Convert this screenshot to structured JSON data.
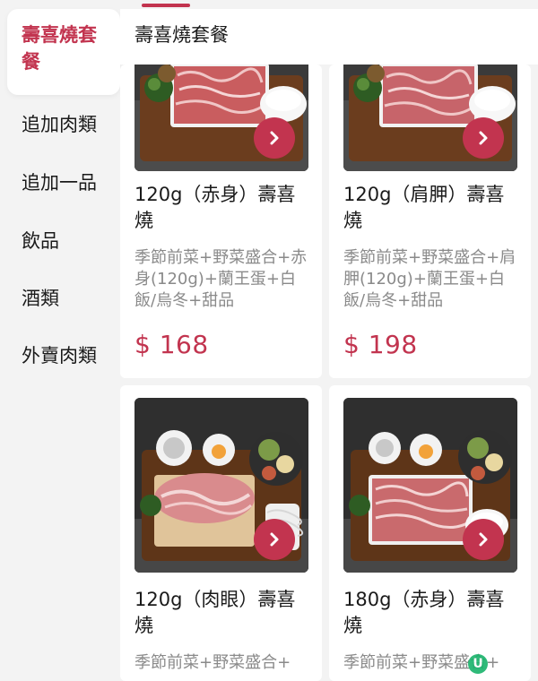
{
  "sidebar": {
    "items": [
      {
        "label": "壽喜燒套餐",
        "active": true
      },
      {
        "label": "追加肉類",
        "active": false
      },
      {
        "label": "追加一品",
        "active": false
      },
      {
        "label": "飲品",
        "active": false
      },
      {
        "label": "酒類",
        "active": false
      },
      {
        "label": "外賣肉類",
        "active": false
      }
    ]
  },
  "section": {
    "title": "壽喜燒套餐"
  },
  "products": [
    {
      "title": "120g（赤身）壽喜燒",
      "description": "季節前菜+野菜盛合+赤身(120g)+蘭王蛋+白飯/烏冬+甜品",
      "price": "$ 168"
    },
    {
      "title": "120g（肩胛）壽喜燒",
      "description": "季節前菜+野菜盛合+肩胛(120g)+蘭王蛋+白飯/烏冬+甜品",
      "price": "$ 198"
    },
    {
      "title": "120g（肉眼）壽喜燒",
      "description": "季節前菜+野菜盛合+",
      "price": ""
    },
    {
      "title": "180g（赤身）壽喜燒",
      "description": "季節前菜+野菜盛合+",
      "price": ""
    }
  ],
  "colors": {
    "accent": "#c2344f",
    "background": "#f3f3f3",
    "card": "#ffffff",
    "muted_text": "#8a8a8a"
  },
  "icons": {
    "open": "chevron-right-icon"
  }
}
